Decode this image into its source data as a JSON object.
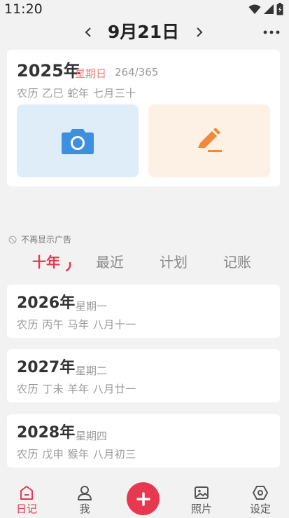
{
  "status_bar": {
    "time": "11:20"
  },
  "header": {
    "date": "9月21日"
  },
  "today": {
    "year": "2025年",
    "weekday": "星期日",
    "progress": "264/365",
    "lunar": "农历  乙巳 蛇年 七月三十"
  },
  "ad_notice": "不再显示广告",
  "tabs": [
    {
      "label": "十年"
    },
    {
      "label": "最近"
    },
    {
      "label": "计划"
    },
    {
      "label": "记账"
    }
  ],
  "years": [
    {
      "year": "2026年",
      "weekday": "星期一",
      "lunar": "农历  丙午 马年 八月十一"
    },
    {
      "year": "2027年",
      "weekday": "星期二",
      "lunar": "农历  丁未 羊年 八月廿一"
    },
    {
      "year": "2028年",
      "weekday": "星期四",
      "lunar": "农历  戊申 猴年 八月初三"
    }
  ],
  "bottom_nav": [
    {
      "label": "日记",
      "icon": "diary-icon"
    },
    {
      "label": "我",
      "icon": "person-icon"
    },
    {
      "label": "照片",
      "icon": "image-icon"
    },
    {
      "label": "设定",
      "icon": "settings-icon"
    }
  ],
  "colors": {
    "accent": "#e8384f",
    "camera": "#3d8fe0",
    "pen": "#f08a3a",
    "lunar_weekday": "#f07a7a"
  }
}
